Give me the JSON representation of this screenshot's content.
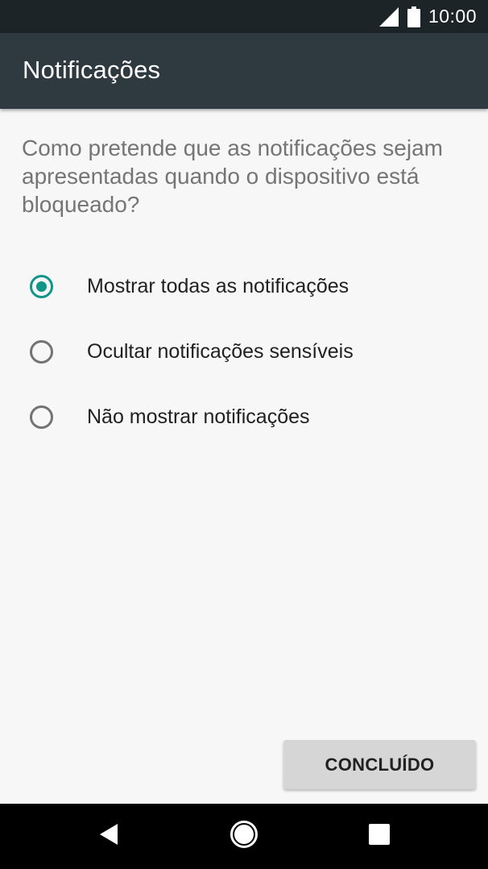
{
  "status_bar": {
    "time": "10:00",
    "icons": [
      "signal-icon",
      "battery-icon"
    ]
  },
  "app_bar": {
    "title": "Notificações"
  },
  "question": "Como pretende que as notificações sejam apresentadas quando o dispositivo está bloqueado?",
  "options": [
    {
      "label": "Mostrar todas as notificações",
      "selected": true
    },
    {
      "label": "Ocultar notificações sensíveis",
      "selected": false
    },
    {
      "label": "Não mostrar notificações",
      "selected": false
    }
  ],
  "done_button": {
    "label": "CONCLUÍDO"
  },
  "nav_bar": {
    "icons": [
      "back-icon",
      "home-icon",
      "recents-icon"
    ]
  },
  "colors": {
    "status_bar": "#1d2427",
    "app_bar": "#2e3a40",
    "accent": "#109688",
    "background": "#f7f7f7"
  }
}
